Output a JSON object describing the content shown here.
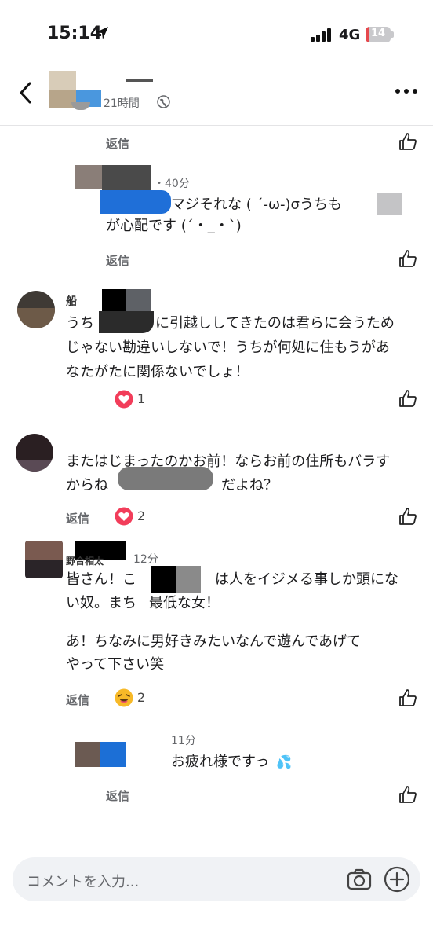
{
  "status_bar": {
    "time": "15:14",
    "network": "4G",
    "battery": "14",
    "battery_level": 0.14
  },
  "header": {
    "post_time": "21時間",
    "icons": {
      "back": "back-chevron-icon",
      "visibility": "globe-icon",
      "more": "more-dots-icon"
    }
  },
  "labels": {
    "reply": "返信"
  },
  "comments": [
    {
      "id": "c1",
      "reply_label": "返信"
    },
    {
      "id": "c2",
      "time": "・40分",
      "text_lines": [
        "マジそれな ( ´-ω-)σうちも",
        "が心配です (´・_・`)"
      ],
      "reply_label": "返信"
    },
    {
      "id": "c3",
      "author_fragment": "船",
      "text_lines": [
        "うち",
        "に引越ししてきたのは君らに会うため",
        "じゃない勘違いしないで！うちが何処に住もうがあ",
        "なたがたに関係ないでしょ！"
      ],
      "reaction": {
        "icon": "heart-icon",
        "count": "1"
      }
    },
    {
      "id": "c4",
      "text_lines": [
        "またはじまったのかお前！ならお前の住所もバラす",
        "からね",
        "だよね？"
      ],
      "reply_label": "返信",
      "reaction": {
        "icon": "heart-icon",
        "count": "2"
      }
    },
    {
      "id": "c5",
      "author_fragment": "野合相太",
      "time": "12分",
      "text_lines": [
        "皆さん！こ",
        "は人をイジメる事しか頭にな",
        "い奴。まち",
        "最低な女！",
        "",
        "あ！ちなみに男好きみたいなんで遊んであげて",
        "やって下さい笑"
      ],
      "reply_label": "返信",
      "reaction": {
        "icon": "laughing-emoji-icon",
        "count": "2"
      }
    },
    {
      "id": "c6",
      "time": "11分",
      "text_lines": [
        "お疲れ様ですっ",
        "💦"
      ],
      "reply_label": "返信"
    }
  ],
  "composer": {
    "placeholder": "コメントを入力...",
    "icons": {
      "camera": "camera-icon",
      "add": "add-circle-icon"
    }
  },
  "colors": {
    "heart": "#f23d5a",
    "meta_text": "#65676b",
    "input_bg": "#f0f2f5",
    "battery_low": "#e5484d"
  }
}
